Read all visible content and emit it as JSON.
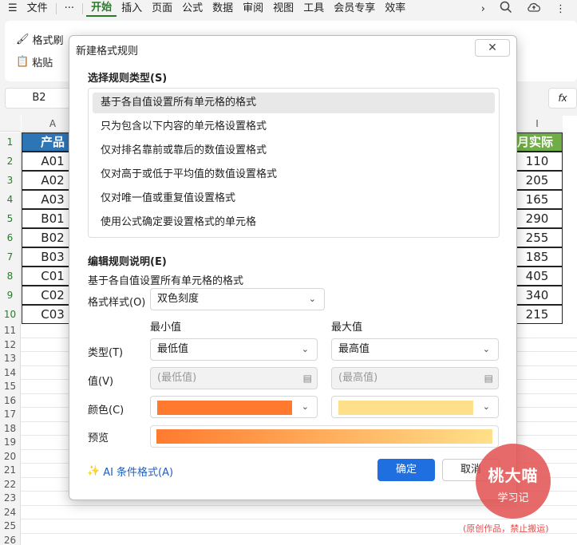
{
  "menubar": {
    "menu_icon": "☰",
    "file": "文件",
    "more": "···",
    "tabs": [
      "开始",
      "插入",
      "页面",
      "公式",
      "数据",
      "审阅",
      "视图",
      "工具",
      "会员专享",
      "效率"
    ],
    "active_tab": "开始"
  },
  "toolbar": {
    "format_painter": "格式刷",
    "paste": "粘贴"
  },
  "namebox": "B2",
  "fx": "fx",
  "columns": {
    "a": "A",
    "i": "I"
  },
  "table_a": {
    "header": "产品",
    "values": [
      "A01",
      "A02",
      "A03",
      "B01",
      "B02",
      "B03",
      "C01",
      "C02",
      "C03"
    ]
  },
  "table_i": {
    "header": "月实际",
    "values": [
      "110",
      "205",
      "165",
      "290",
      "255",
      "185",
      "405",
      "340",
      "215"
    ]
  },
  "row_numbers": [
    "1",
    "2",
    "3",
    "4",
    "5",
    "6",
    "7",
    "8",
    "9",
    "10",
    "11",
    "12",
    "13",
    "14",
    "15",
    "16",
    "17",
    "18",
    "19",
    "20",
    "21",
    "22",
    "23",
    "24",
    "25",
    "26"
  ],
  "dialog": {
    "title": "新建格式规则",
    "close": "✕",
    "rule_type_label": "选择规则类型(S)",
    "rule_types": [
      "基于各自值设置所有单元格的格式",
      "只为包含以下内容的单元格设置格式",
      "仅对排名靠前或靠后的数值设置格式",
      "仅对高于或低于平均值的数值设置格式",
      "仅对唯一值或重复值设置格式",
      "使用公式确定要设置格式的单元格"
    ],
    "edit_label": "编辑规则说明(E)",
    "description": "基于各自值设置所有单元格的格式",
    "format_style_label": "格式样式(O)",
    "format_style_value": "双色刻度",
    "min_header": "最小值",
    "max_header": "最大值",
    "type_label": "类型(T)",
    "min_type": "最低值",
    "max_type": "最高值",
    "value_label": "值(V)",
    "min_value_placeholder": "(最低值)",
    "max_value_placeholder": "(最高值)",
    "color_label": "颜色(C)",
    "min_color": "#ff7a2e",
    "max_color": "#ffe08a",
    "preview_label": "预览",
    "ai_link": "AI 条件格式(A)",
    "ok": "确定",
    "cancel": "取消"
  },
  "watermark": {
    "line1": "桃大喵",
    "line2": "学习记",
    "note": "(原创作品，禁止搬运)"
  }
}
